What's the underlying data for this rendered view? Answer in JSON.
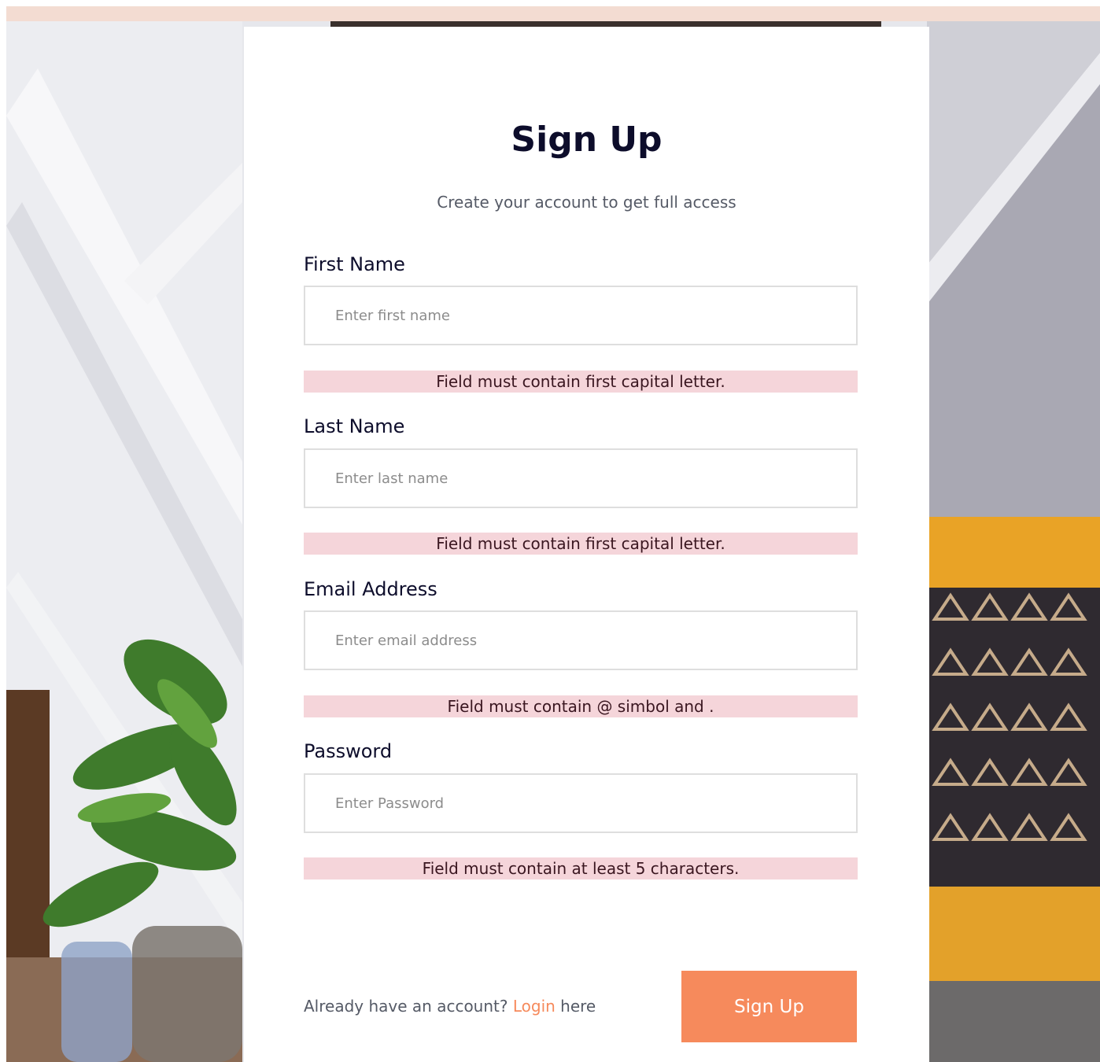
{
  "form": {
    "title": "Sign Up",
    "subtitle": "Create your account to get full access",
    "fields": [
      {
        "label": "First Name",
        "placeholder": "Enter first name",
        "value": "",
        "error": "Field must contain first capital letter."
      },
      {
        "label": "Last Name",
        "placeholder": "Enter last name",
        "value": "",
        "error": "Field must contain first capital letter."
      },
      {
        "label": "Email Address",
        "placeholder": "Enter email address",
        "value": "",
        "error": "Field must contain @ simbol and ."
      },
      {
        "label": "Password",
        "placeholder": "Enter Password",
        "value": "",
        "error": "Field must contain at least 5 characters."
      }
    ],
    "footer": {
      "prefix": "Already have an account?",
      "link": "Login",
      "suffix": "here"
    },
    "submit_label": "Sign Up"
  },
  "colors": {
    "accent": "#f68a5c",
    "error_background": "#f5d5da",
    "heading": "#0d0d2b"
  }
}
